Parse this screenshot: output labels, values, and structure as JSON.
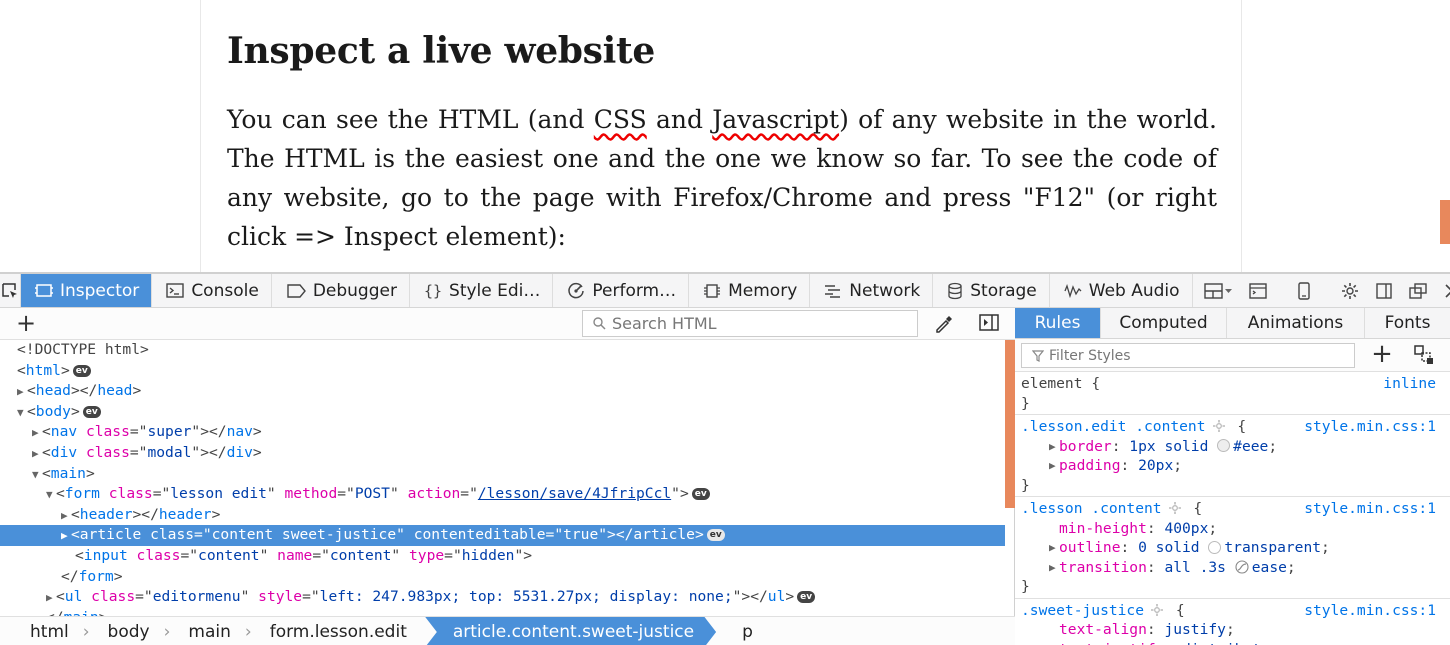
{
  "page": {
    "heading": "Inspect a live website",
    "paragraph_parts": [
      "You can see the HTML (and ",
      "CSS",
      " and ",
      "Javascript",
      ") of any website in the world. The HTML is the easiest one and the one we know so far. To see the code of any website, go to the page with Firefox/Chrome and press \"F12\" (or right click => Inspect element):"
    ]
  },
  "toolbar": {
    "tabs": [
      "Inspector",
      "Console",
      "Debugger",
      "Style Edi…",
      "Perform…",
      "Memory",
      "Network",
      "Storage",
      "Web Audio"
    ],
    "selected_tab": "Inspector"
  },
  "markup": {
    "search_placeholder": "Search HTML",
    "ev_label": "ev",
    "lines": [
      {
        "doctype": "<!DOCTYPE html>"
      },
      {
        "html": "html"
      },
      {
        "head": "head"
      },
      {
        "body": "body"
      },
      {
        "nav_tag": "nav",
        "nav_attr": "class",
        "nav_val": "super"
      },
      {
        "div_tag": "div",
        "div_attr": "class",
        "div_val": "modal"
      },
      {
        "main": "main"
      },
      {
        "form_tag": "form",
        "a1": "class",
        "v1": "lesson edit",
        "a2": "method",
        "v2": "POST",
        "a3": "action",
        "v3": "/lesson/save/4JfripCcl"
      },
      {
        "header": "header"
      },
      {
        "article_tag": "article",
        "a1": "class",
        "v1": "content sweet-justice",
        "a2": "contenteditable",
        "v2": "true"
      },
      {
        "input_tag": "input",
        "a1": "class",
        "v1": "content",
        "a2": "name",
        "v2": "content",
        "a3": "type",
        "v3": "hidden"
      },
      {
        "form_close": "form"
      },
      {
        "ul_tag": "ul",
        "a1": "class",
        "v1": "editormenu",
        "a2": "style",
        "v2": "left: 247.983px; top: 5531.27px; display: none;"
      },
      {
        "main_close": "main"
      }
    ]
  },
  "breadcrumbs": [
    "html",
    "body",
    "main",
    "form.lesson.edit",
    "article.content.sweet-justice",
    "p"
  ],
  "sidebar": {
    "tabs": [
      "Rules",
      "Computed",
      "Animations",
      "Fonts"
    ],
    "selected_tab": "Rules",
    "filter_placeholder": "Filter Styles",
    "rules": [
      {
        "selector": "element",
        "source": "inline",
        "decls": []
      },
      {
        "selector": ".lesson.edit .content",
        "source": "style.min.css:1",
        "decls": [
          {
            "prop": "border",
            "value_pre": "1px solid ",
            "swatch": "#eeeeee",
            "value": "#eee"
          },
          {
            "prop": "padding",
            "value": "20px"
          }
        ]
      },
      {
        "selector": ".lesson .content",
        "source": "style.min.css:1",
        "decls": [
          {
            "prop": "min-height",
            "value": "400px"
          },
          {
            "prop": "outline",
            "value_pre": "0 solid ",
            "swatch": "#ffffff",
            "value": "transparent"
          },
          {
            "prop": "transition",
            "value_pre": "all .3s ",
            "value": "ease"
          }
        ]
      },
      {
        "selector": ".sweet-justice",
        "source": "style.min.css:1",
        "decls": [
          {
            "prop": "text-align",
            "value": "justify"
          },
          {
            "prop": "text-justify",
            "value": "distribute"
          }
        ]
      }
    ]
  },
  "colors": {
    "accent": "#4a90d9",
    "scroll_thumb": "#e8885c",
    "tag": "#0074e8",
    "attr": "#dd00a9",
    "value": "#003eaa"
  }
}
